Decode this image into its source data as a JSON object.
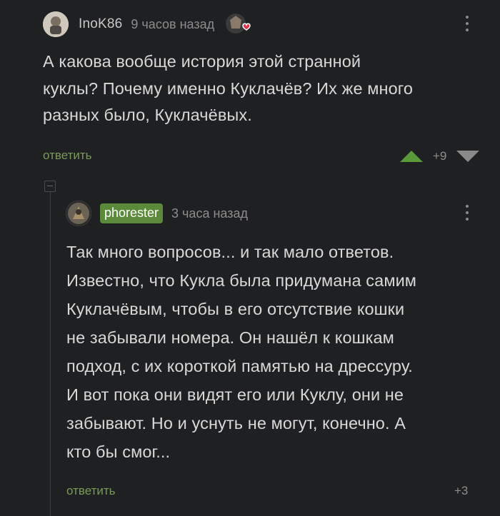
{
  "comment": {
    "username": "InoK86",
    "time": "9 часов назад",
    "text_lines": [
      "А какова вообще история этой странной",
      "куклы? Почему именно Куклачёв? Их же много",
      "разных было, Куклачёвых."
    ],
    "reply_label": "ответить",
    "score": "+9"
  },
  "reply": {
    "username": "phorester",
    "time": "3 часа назад",
    "text_lines": [
      "Так много вопросов... и так мало ответов.",
      "Известно, что Кукла была придумана самим",
      "Куклачёвым, чтобы в его отсутствие кошки",
      "не забывали номера. Он нашёл к кошкам",
      "подход, с их короткой памятью на дрессуру.",
      "И вот пока они видят его или Куклу, они не",
      "забывают. Но и уснуть не могут, конечно. А",
      "кто бы смог..."
    ],
    "reply_label": "ответить",
    "score": "+3"
  },
  "colors": {
    "background": "#1f2022",
    "accent_green": "#5b8a3a",
    "link_green": "#7a9a5a"
  },
  "icons": [
    "avatar-image",
    "award-heart-icon",
    "more-vert-icon",
    "upvote-icon",
    "downvote-icon",
    "collapse-thread-icon"
  ]
}
